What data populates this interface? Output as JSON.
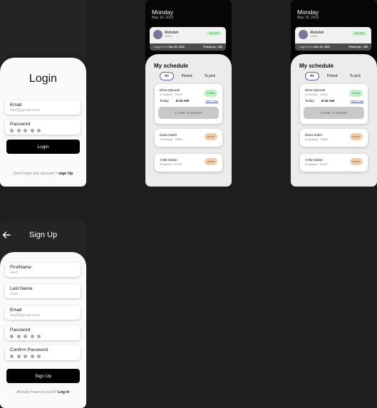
{
  "login": {
    "title": "Login",
    "email_label": "Email",
    "email_value": "had@gmail.com",
    "password_label": "Password",
    "button": "Login",
    "footer_text": "Don't have any account ?",
    "footer_link": "sign Up"
  },
  "signup": {
    "title": "Sign Up",
    "back_icon": "arrow-left-icon",
    "fields": [
      {
        "label": "FirstName",
        "value": "Had"
      },
      {
        "label": "Last Name",
        "value": "Had"
      },
      {
        "label": "Email",
        "value": "had@gmail.com"
      }
    ],
    "password_label": "Password",
    "confirm_label": "Confirm Password",
    "button": "Sign Up",
    "footer_text": "Already have account?",
    "footer_link": "Log in"
  },
  "schedule": {
    "day": "Monday",
    "date": "May 19, 2023",
    "user": {
      "name": "Abdullah",
      "role": "rsktive",
      "status": "ONLINE",
      "logged_prefix": "Logged from",
      "logged_date": "Dec 30, 2022",
      "picked_label": "Picked up : 150"
    },
    "heading": "My schedule",
    "tabs": [
      "All",
      "Picked",
      "To pick"
    ],
    "cards": [
      {
        "name": "Dima Qanuati",
        "address": "Al-Naimen - 50637",
        "status": "To pick",
        "day": "Today",
        "time": "8:15 AM",
        "map": "Open map",
        "distance": "1.2 KM - 5 min EST"
      },
      {
        "name": "Dana Saleh",
        "address": "Al-Rhayad - 50682",
        "status": "picked"
      },
      {
        "name": "Anfal Sultan",
        "address": "Al-Ajawed - 51287",
        "status": "picked"
      }
    ]
  },
  "colors": {
    "accent": "#6563a8",
    "online": "#c6f2c9",
    "picked": "#f1ceab",
    "topick": "#bff0c6"
  }
}
